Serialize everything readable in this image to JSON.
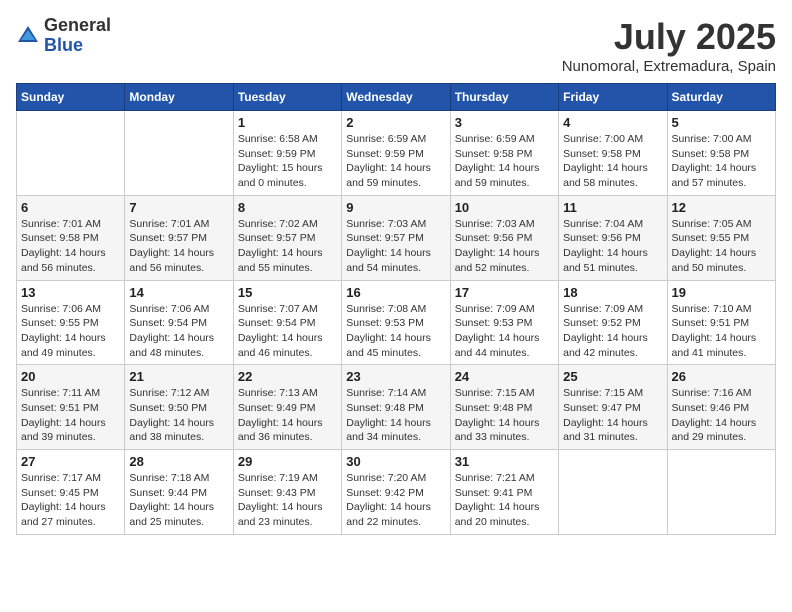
{
  "header": {
    "logo_general": "General",
    "logo_blue": "Blue",
    "month_year": "July 2025",
    "location": "Nunomoral, Extremadura, Spain"
  },
  "weekdays": [
    "Sunday",
    "Monday",
    "Tuesday",
    "Wednesday",
    "Thursday",
    "Friday",
    "Saturday"
  ],
  "weeks": [
    [
      {
        "day": "",
        "sunrise": "",
        "sunset": "",
        "daylight": ""
      },
      {
        "day": "",
        "sunrise": "",
        "sunset": "",
        "daylight": ""
      },
      {
        "day": "1",
        "sunrise": "Sunrise: 6:58 AM",
        "sunset": "Sunset: 9:59 PM",
        "daylight": "Daylight: 15 hours and 0 minutes."
      },
      {
        "day": "2",
        "sunrise": "Sunrise: 6:59 AM",
        "sunset": "Sunset: 9:59 PM",
        "daylight": "Daylight: 14 hours and 59 minutes."
      },
      {
        "day": "3",
        "sunrise": "Sunrise: 6:59 AM",
        "sunset": "Sunset: 9:58 PM",
        "daylight": "Daylight: 14 hours and 59 minutes."
      },
      {
        "day": "4",
        "sunrise": "Sunrise: 7:00 AM",
        "sunset": "Sunset: 9:58 PM",
        "daylight": "Daylight: 14 hours and 58 minutes."
      },
      {
        "day": "5",
        "sunrise": "Sunrise: 7:00 AM",
        "sunset": "Sunset: 9:58 PM",
        "daylight": "Daylight: 14 hours and 57 minutes."
      }
    ],
    [
      {
        "day": "6",
        "sunrise": "Sunrise: 7:01 AM",
        "sunset": "Sunset: 9:58 PM",
        "daylight": "Daylight: 14 hours and 56 minutes."
      },
      {
        "day": "7",
        "sunrise": "Sunrise: 7:01 AM",
        "sunset": "Sunset: 9:57 PM",
        "daylight": "Daylight: 14 hours and 56 minutes."
      },
      {
        "day": "8",
        "sunrise": "Sunrise: 7:02 AM",
        "sunset": "Sunset: 9:57 PM",
        "daylight": "Daylight: 14 hours and 55 minutes."
      },
      {
        "day": "9",
        "sunrise": "Sunrise: 7:03 AM",
        "sunset": "Sunset: 9:57 PM",
        "daylight": "Daylight: 14 hours and 54 minutes."
      },
      {
        "day": "10",
        "sunrise": "Sunrise: 7:03 AM",
        "sunset": "Sunset: 9:56 PM",
        "daylight": "Daylight: 14 hours and 52 minutes."
      },
      {
        "day": "11",
        "sunrise": "Sunrise: 7:04 AM",
        "sunset": "Sunset: 9:56 PM",
        "daylight": "Daylight: 14 hours and 51 minutes."
      },
      {
        "day": "12",
        "sunrise": "Sunrise: 7:05 AM",
        "sunset": "Sunset: 9:55 PM",
        "daylight": "Daylight: 14 hours and 50 minutes."
      }
    ],
    [
      {
        "day": "13",
        "sunrise": "Sunrise: 7:06 AM",
        "sunset": "Sunset: 9:55 PM",
        "daylight": "Daylight: 14 hours and 49 minutes."
      },
      {
        "day": "14",
        "sunrise": "Sunrise: 7:06 AM",
        "sunset": "Sunset: 9:54 PM",
        "daylight": "Daylight: 14 hours and 48 minutes."
      },
      {
        "day": "15",
        "sunrise": "Sunrise: 7:07 AM",
        "sunset": "Sunset: 9:54 PM",
        "daylight": "Daylight: 14 hours and 46 minutes."
      },
      {
        "day": "16",
        "sunrise": "Sunrise: 7:08 AM",
        "sunset": "Sunset: 9:53 PM",
        "daylight": "Daylight: 14 hours and 45 minutes."
      },
      {
        "day": "17",
        "sunrise": "Sunrise: 7:09 AM",
        "sunset": "Sunset: 9:53 PM",
        "daylight": "Daylight: 14 hours and 44 minutes."
      },
      {
        "day": "18",
        "sunrise": "Sunrise: 7:09 AM",
        "sunset": "Sunset: 9:52 PM",
        "daylight": "Daylight: 14 hours and 42 minutes."
      },
      {
        "day": "19",
        "sunrise": "Sunrise: 7:10 AM",
        "sunset": "Sunset: 9:51 PM",
        "daylight": "Daylight: 14 hours and 41 minutes."
      }
    ],
    [
      {
        "day": "20",
        "sunrise": "Sunrise: 7:11 AM",
        "sunset": "Sunset: 9:51 PM",
        "daylight": "Daylight: 14 hours and 39 minutes."
      },
      {
        "day": "21",
        "sunrise": "Sunrise: 7:12 AM",
        "sunset": "Sunset: 9:50 PM",
        "daylight": "Daylight: 14 hours and 38 minutes."
      },
      {
        "day": "22",
        "sunrise": "Sunrise: 7:13 AM",
        "sunset": "Sunset: 9:49 PM",
        "daylight": "Daylight: 14 hours and 36 minutes."
      },
      {
        "day": "23",
        "sunrise": "Sunrise: 7:14 AM",
        "sunset": "Sunset: 9:48 PM",
        "daylight": "Daylight: 14 hours and 34 minutes."
      },
      {
        "day": "24",
        "sunrise": "Sunrise: 7:15 AM",
        "sunset": "Sunset: 9:48 PM",
        "daylight": "Daylight: 14 hours and 33 minutes."
      },
      {
        "day": "25",
        "sunrise": "Sunrise: 7:15 AM",
        "sunset": "Sunset: 9:47 PM",
        "daylight": "Daylight: 14 hours and 31 minutes."
      },
      {
        "day": "26",
        "sunrise": "Sunrise: 7:16 AM",
        "sunset": "Sunset: 9:46 PM",
        "daylight": "Daylight: 14 hours and 29 minutes."
      }
    ],
    [
      {
        "day": "27",
        "sunrise": "Sunrise: 7:17 AM",
        "sunset": "Sunset: 9:45 PM",
        "daylight": "Daylight: 14 hours and 27 minutes."
      },
      {
        "day": "28",
        "sunrise": "Sunrise: 7:18 AM",
        "sunset": "Sunset: 9:44 PM",
        "daylight": "Daylight: 14 hours and 25 minutes."
      },
      {
        "day": "29",
        "sunrise": "Sunrise: 7:19 AM",
        "sunset": "Sunset: 9:43 PM",
        "daylight": "Daylight: 14 hours and 23 minutes."
      },
      {
        "day": "30",
        "sunrise": "Sunrise: 7:20 AM",
        "sunset": "Sunset: 9:42 PM",
        "daylight": "Daylight: 14 hours and 22 minutes."
      },
      {
        "day": "31",
        "sunrise": "Sunrise: 7:21 AM",
        "sunset": "Sunset: 9:41 PM",
        "daylight": "Daylight: 14 hours and 20 minutes."
      },
      {
        "day": "",
        "sunrise": "",
        "sunset": "",
        "daylight": ""
      },
      {
        "day": "",
        "sunrise": "",
        "sunset": "",
        "daylight": ""
      }
    ]
  ]
}
